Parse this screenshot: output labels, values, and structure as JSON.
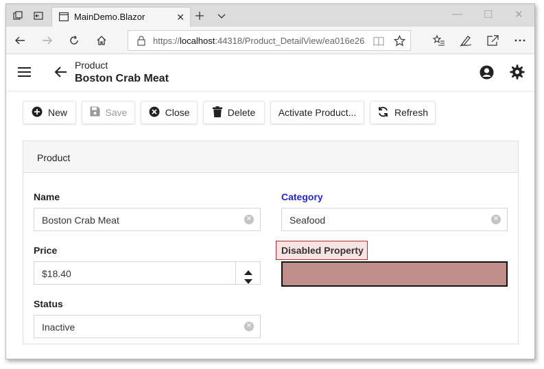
{
  "browser": {
    "tab_title": "MainDemo.Blazor",
    "url_prefix": "https://",
    "url_host": "localhost",
    "url_rest": ":44318/Product_DetailView/ea016e26"
  },
  "header": {
    "breadcrumb": "Product",
    "title": "Boston Crab Meat"
  },
  "toolbar": {
    "new_label": "New",
    "save_label": "Save",
    "close_label": "Close",
    "delete_label": "Delete",
    "activate_label": "Activate Product...",
    "refresh_label": "Refresh"
  },
  "group": {
    "title": "Product"
  },
  "fields": {
    "name_label": "Name",
    "name_value": "Boston Crab Meat",
    "category_label": "Category",
    "category_value": "Seafood",
    "price_label": "Price",
    "price_value": "$18.40",
    "disabled_label": "Disabled Property",
    "status_label": "Status",
    "status_value": "Inactive"
  },
  "icons": [
    "tab-actions-icon",
    "tabs-aside-icon",
    "page-icon",
    "close-icon",
    "new-tab-icon",
    "chevron-down-icon",
    "back-icon",
    "forward-icon",
    "refresh-icon",
    "home-icon",
    "lock-icon",
    "reading-view-icon",
    "star-icon",
    "favorites-icon",
    "pen-icon",
    "share-icon",
    "more-icon",
    "hamburger-icon",
    "arrow-left-icon",
    "account-icon",
    "gear-icon",
    "plus-circle-icon",
    "save-icon",
    "close-circle-icon",
    "trash-icon",
    "sync-icon",
    "spin-up-icon",
    "spin-down-icon"
  ]
}
